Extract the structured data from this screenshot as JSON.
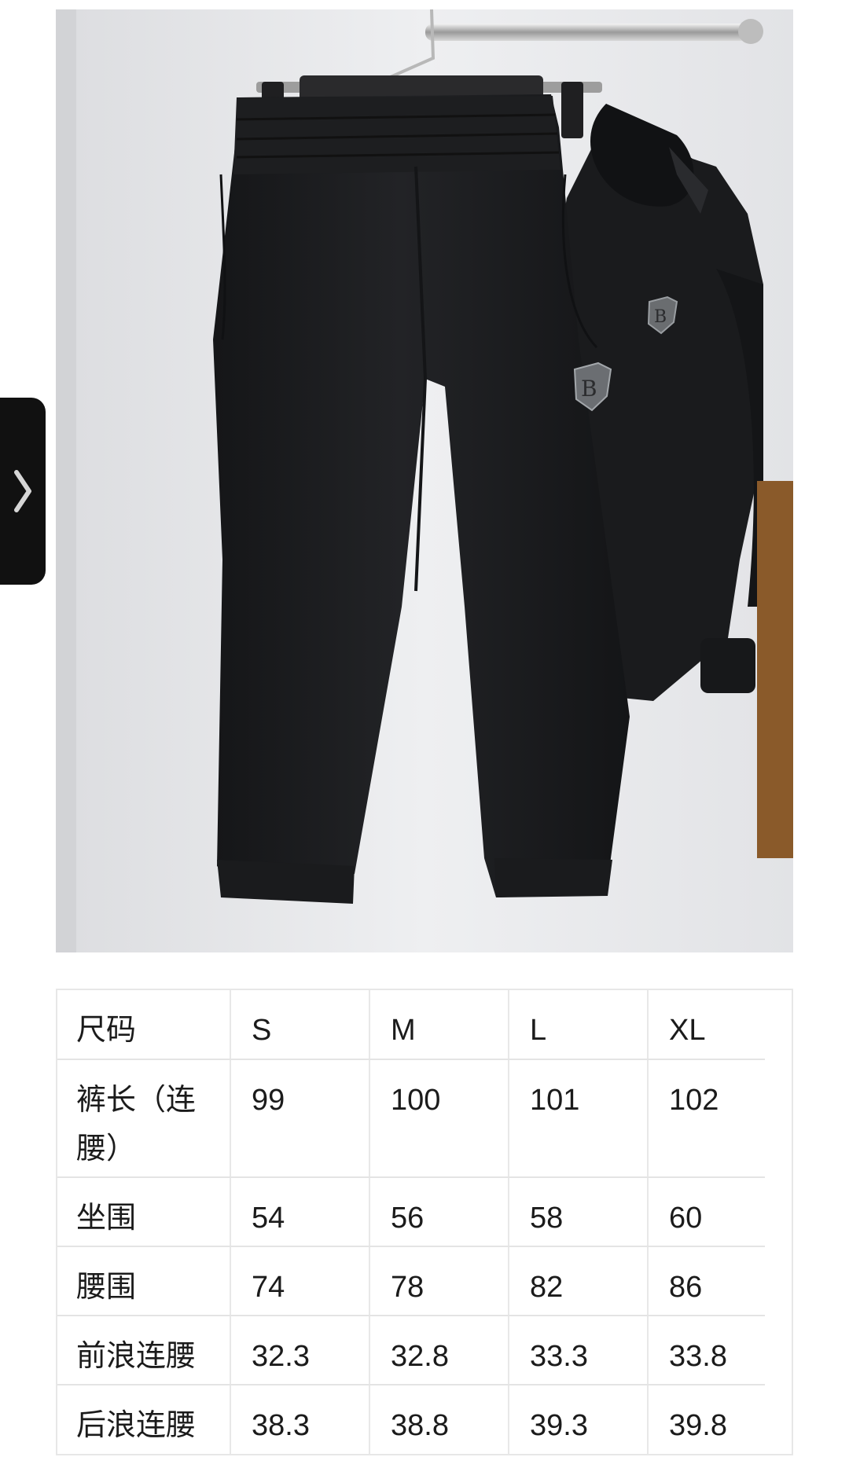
{
  "colors": {
    "garment": "#1b1c1e",
    "background_wall": "#e9eaec",
    "handle": "#111111",
    "table_border": "#e4e4e4",
    "text": "#1b1b1b"
  },
  "icons": {
    "side_handle": "chevron-right-icon",
    "patch": "shield-logo-patch"
  },
  "size_table": {
    "header": [
      "尺码",
      "S",
      "M",
      "L",
      "XL"
    ],
    "rows": [
      {
        "label": "裤长（连腰）",
        "values": [
          "99",
          "100",
          "101",
          "102"
        ]
      },
      {
        "label": "坐围",
        "values": [
          "54",
          "56",
          "58",
          "60"
        ]
      },
      {
        "label": "腰围",
        "values": [
          "74",
          "78",
          "82",
          "86"
        ]
      },
      {
        "label": "前浪连腰",
        "values": [
          "32.3",
          "32.8",
          "33.3",
          "33.8"
        ]
      },
      {
        "label": "后浪连腰",
        "values": [
          "38.3",
          "38.8",
          "39.3",
          "39.8"
        ]
      }
    ]
  }
}
